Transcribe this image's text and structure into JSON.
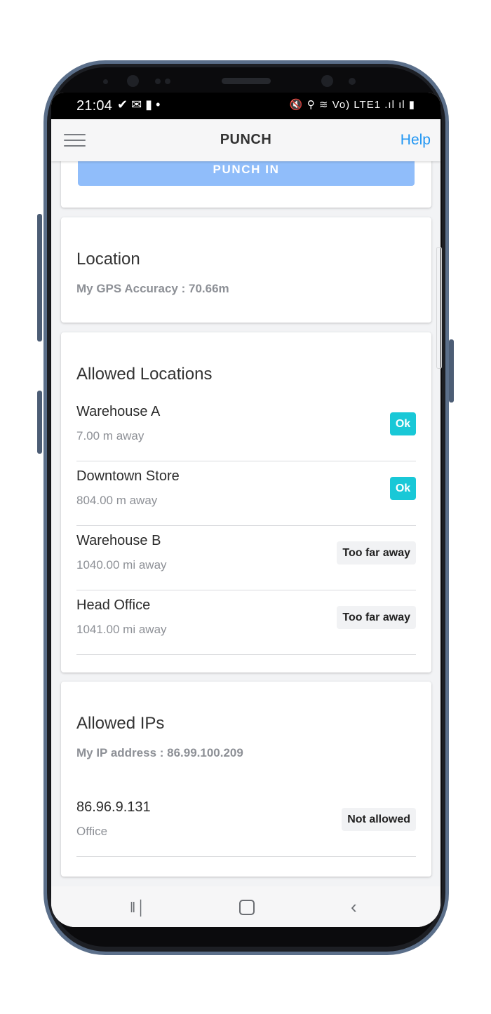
{
  "status_bar": {
    "time": "21:04",
    "left_icons": "✔ ✉ ▮ •",
    "right_icons": "🔇 ⚲ ≋ Vo) LTE1 .ıl ıl ▮"
  },
  "app_bar": {
    "title": "PUNCH",
    "help_label": "Help"
  },
  "punch": {
    "button_label": "PUNCH IN",
    "accent_color": "#90bdfa"
  },
  "location": {
    "title": "Location",
    "gps_accuracy": "My GPS Accuracy : 70.66m"
  },
  "allowed_locations": {
    "title": "Allowed Locations",
    "items": [
      {
        "name": "Warehouse A",
        "distance": "7.00 m away",
        "status": "Ok"
      },
      {
        "name": "Downtown Store",
        "distance": "804.00 m away",
        "status": "Ok"
      },
      {
        "name": "Warehouse B",
        "distance": "1040.00 mi away",
        "status": "Too far away"
      },
      {
        "name": "Head Office",
        "distance": "1041.00 mi away",
        "status": "Too far away"
      }
    ],
    "ok_color": "#19c8d7"
  },
  "allowed_ips": {
    "title": "Allowed IPs",
    "my_ip": "My IP address : 86.99.100.209",
    "items": [
      {
        "ip": "86.96.9.131",
        "label": "Office",
        "status": "Not allowed"
      }
    ]
  },
  "nav_bar": {
    "recents_icon": "recents-icon",
    "home_icon": "home-icon",
    "back_icon": "back-icon"
  }
}
